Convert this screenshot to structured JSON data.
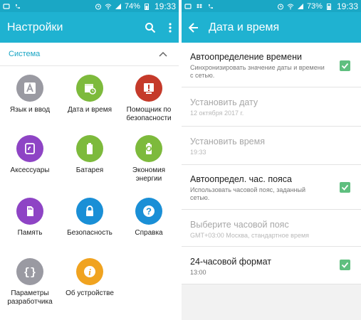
{
  "left": {
    "status": {
      "battery": "74%",
      "time": "19:33"
    },
    "appbar": {
      "title": "Настройки"
    },
    "section": {
      "title": "Система"
    },
    "items": [
      {
        "label": "Язык и ввод",
        "icon": "language-icon",
        "color": "#9a9aa2"
      },
      {
        "label": "Дата и время",
        "icon": "calendar-clock-icon",
        "color": "#7dba3c"
      },
      {
        "label": "Помощник по безопасности",
        "icon": "safety-assistant-icon",
        "color": "#c53a2a"
      },
      {
        "label": "Аксессуары",
        "icon": "accessories-icon",
        "color": "#8e44c5"
      },
      {
        "label": "Батарея",
        "icon": "battery-icon",
        "color": "#7dba3c"
      },
      {
        "label": "Экономия энергии",
        "icon": "power-saving-icon",
        "color": "#7dba3c"
      },
      {
        "label": "Память",
        "icon": "memory-card-icon",
        "color": "#8e44c5"
      },
      {
        "label": "Безопасность",
        "icon": "lock-icon",
        "color": "#1a8fd6"
      },
      {
        "label": "Справка",
        "icon": "help-icon",
        "color": "#1a8fd6"
      },
      {
        "label": "Параметры разработчика",
        "icon": "developer-braces-icon",
        "color": "#9a9aa2"
      },
      {
        "label": "Об устройстве",
        "icon": "info-icon",
        "color": "#f0a320"
      }
    ]
  },
  "right": {
    "status": {
      "battery": "73%",
      "time": "19:33"
    },
    "appbar": {
      "title": "Дата и время"
    },
    "rows": [
      {
        "title": "Автоопределение времени",
        "subtitle": "Синхронизировать значение даты и времени с сетью.",
        "checked": true,
        "enabled": true
      },
      {
        "title": "Установить дату",
        "subtitle": "12 октября 2017 г.",
        "checked": false,
        "enabled": false
      },
      {
        "title": "Установить время",
        "subtitle": "19:33",
        "checked": false,
        "enabled": false
      },
      {
        "title": "Автоопредел. час. пояса",
        "subtitle": "Использовать часовой пояс, заданный сетью.",
        "checked": true,
        "enabled": true
      },
      {
        "title": "Выберите часовой пояс",
        "subtitle": "GMT+03:00 Москва, стандартное время",
        "checked": false,
        "enabled": false
      },
      {
        "title": "24-часовой формат",
        "subtitle": "13:00",
        "checked": true,
        "enabled": true
      }
    ]
  }
}
